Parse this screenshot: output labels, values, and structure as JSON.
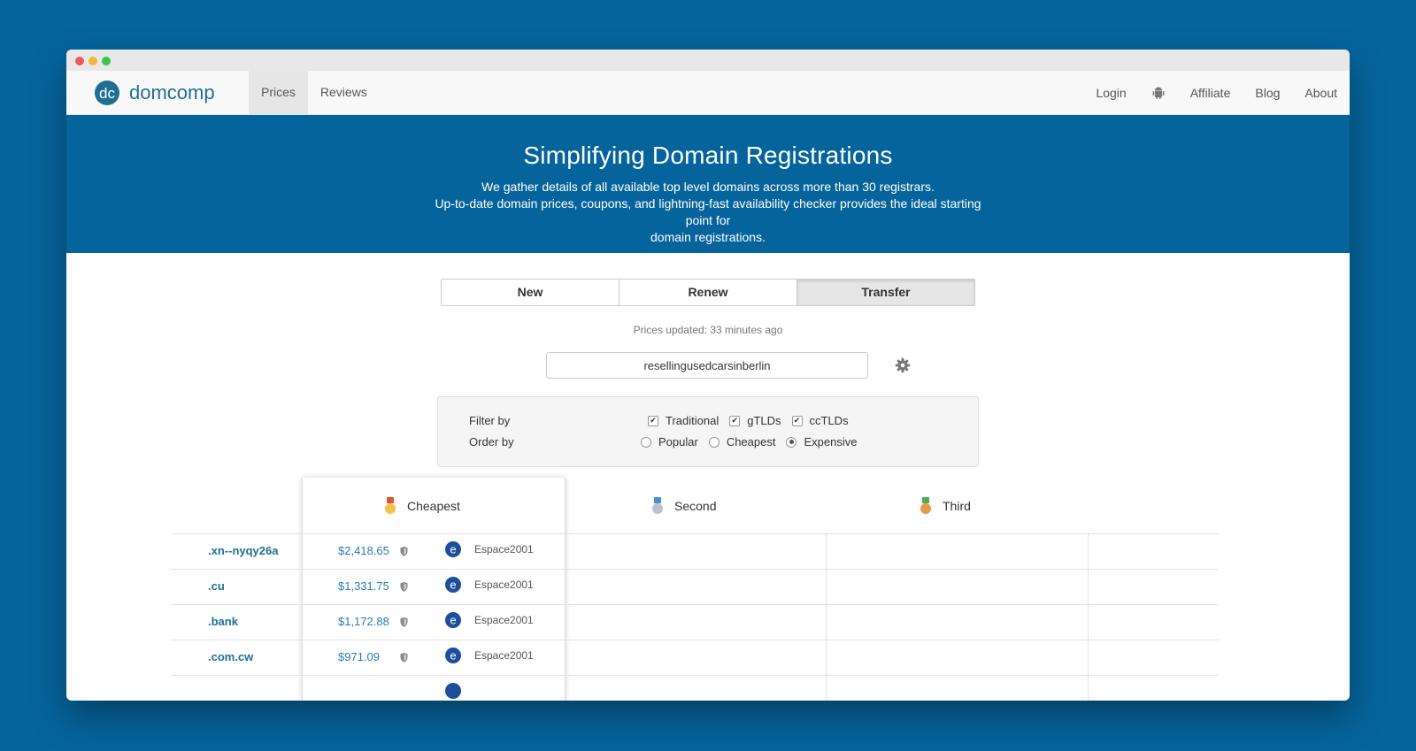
{
  "brand": {
    "logo_text": "dc",
    "name": "domcomp"
  },
  "nav": {
    "left": [
      {
        "label": "Prices",
        "active": true
      },
      {
        "label": "Reviews",
        "active": false
      }
    ],
    "right": {
      "login": "Login",
      "android_icon": "android-icon",
      "affiliate": "Affiliate",
      "blog": "Blog",
      "about": "About"
    }
  },
  "hero": {
    "title": "Simplifying Domain Registrations",
    "line1": "We gather details of all available top level domains across more than 30 registrars.",
    "line2": "Up-to-date domain prices, coupons, and lightning-fast availability checker provides the ideal starting point for",
    "line3": "domain registrations."
  },
  "tabs": [
    {
      "label": "New",
      "active": false
    },
    {
      "label": "Renew",
      "active": false
    },
    {
      "label": "Transfer",
      "active": true
    }
  ],
  "prices_updated": "Prices updated: 33 minutes ago",
  "search": {
    "value": "resellingusedcarsinberlin",
    "settings_icon": "gear-icon"
  },
  "filters": {
    "filter_label": "Filter by",
    "order_label": "Order by",
    "checkboxes": [
      {
        "label": "Traditional",
        "checked": true
      },
      {
        "label": "gTLDs",
        "checked": true
      },
      {
        "label": "ccTLDs",
        "checked": true
      }
    ],
    "radios": [
      {
        "label": "Popular",
        "selected": false
      },
      {
        "label": "Cheapest",
        "selected": false
      },
      {
        "label": "Expensive",
        "selected": true
      }
    ]
  },
  "table": {
    "headers": {
      "first": "Cheapest",
      "second": "Second",
      "third": "Third"
    },
    "rows": [
      {
        "tld": ".xn--nyqy26a",
        "price": "$2,418.65",
        "registrar": "Espace2001"
      },
      {
        "tld": ".cu",
        "price": "$1,331.75",
        "registrar": "Espace2001"
      },
      {
        "tld": ".bank",
        "price": "$1,172.88",
        "registrar": "Espace2001"
      },
      {
        "tld": ".com.cw",
        "price": "$971.09",
        "registrar": "Espace2001"
      }
    ]
  },
  "colors": {
    "brand_blue": "#06649c",
    "link_blue": "#2a7ab8",
    "logo": "#1f6f92"
  }
}
